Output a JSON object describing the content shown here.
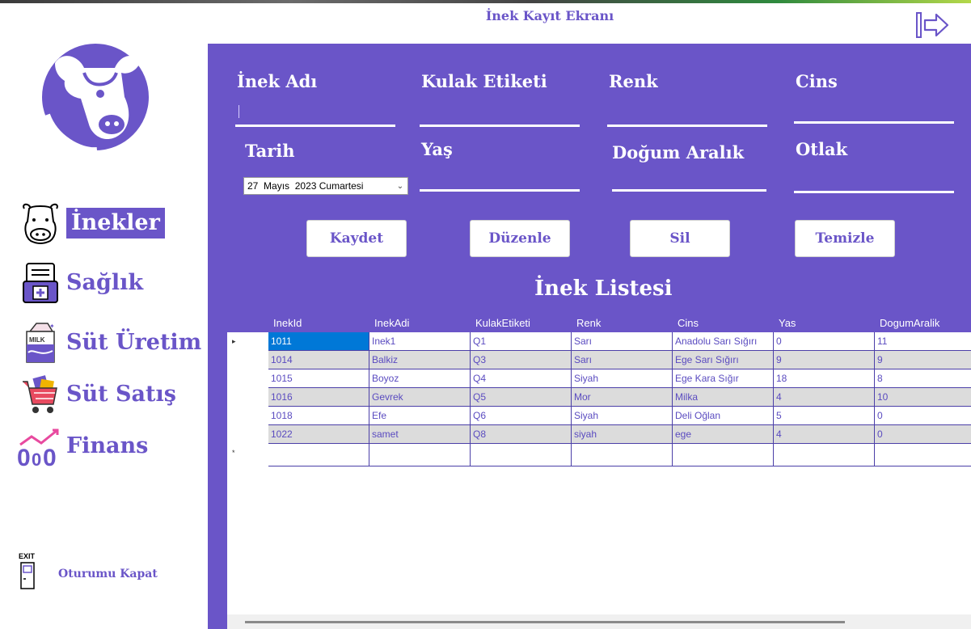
{
  "window": {
    "title": "İnek Kayıt Ekranı"
  },
  "sidebar": {
    "items": [
      {
        "label": "İnekler",
        "icon": "cow-face-icon",
        "active": true
      },
      {
        "label": "Sağlık",
        "icon": "medical-document-icon",
        "active": false
      },
      {
        "label": "Süt Üretim",
        "icon": "milk-carton-icon",
        "active": false
      },
      {
        "label": "Süt Satış",
        "icon": "shopping-cart-icon",
        "active": false
      },
      {
        "label": "Finans",
        "icon": "finance-chart-icon",
        "active": false
      }
    ],
    "logout": {
      "label": "Oturumu Kapat",
      "icon_text": "EXIT"
    }
  },
  "form": {
    "labels": {
      "name": "İnek Adı",
      "tag": "Kulak Etiketi",
      "color": "Renk",
      "breed": "Cins",
      "date": "Tarih",
      "age": "Yaş",
      "birth_interval": "Doğum Aralık",
      "pasture": "Otlak"
    },
    "values": {
      "name": "",
      "tag": "",
      "color": "",
      "breed": "",
      "age": "",
      "birth_interval": "",
      "pasture": ""
    },
    "date": {
      "day": "27",
      "month": "Mayıs",
      "year": "2023",
      "weekday": "Cumartesi"
    }
  },
  "buttons": {
    "save": "Kaydet",
    "edit": "Düzenle",
    "delete": "Sil",
    "clear": "Temizle"
  },
  "list": {
    "title": "İnek Listesi",
    "columns": [
      "InekId",
      "InekAdi",
      "KulakEtiketi",
      "Renk",
      "Cins",
      "Yas",
      "DogumAralik"
    ],
    "rows": [
      [
        "1011",
        "Inek1",
        "Q1",
        "Sarı",
        "Anadolu Sarı Sığırı",
        "0",
        "11"
      ],
      [
        "1014",
        "Balkiz",
        "Q3",
        "Sarı",
        "Ege Sarı Sığırı",
        "9",
        "9"
      ],
      [
        "1015",
        "Boyoz",
        "Q4",
        "Siyah",
        "Ege Kara Sığır",
        "18",
        "8"
      ],
      [
        "1016",
        "Gevrek",
        "Q5",
        "Mor",
        "Milka",
        "4",
        "10"
      ],
      [
        "1018",
        "Efe",
        "Q6",
        "Siyah",
        "Deli Oğlan",
        "5",
        "0"
      ],
      [
        "1022",
        "samet",
        "Q8",
        "siyah",
        "ege",
        "4",
        "0"
      ]
    ],
    "current_row_marker": "▸",
    "new_row_marker": "*"
  },
  "colors": {
    "accent": "#6a55c8",
    "selected": "#0078d7",
    "alt_row": "#dcdcdc"
  }
}
